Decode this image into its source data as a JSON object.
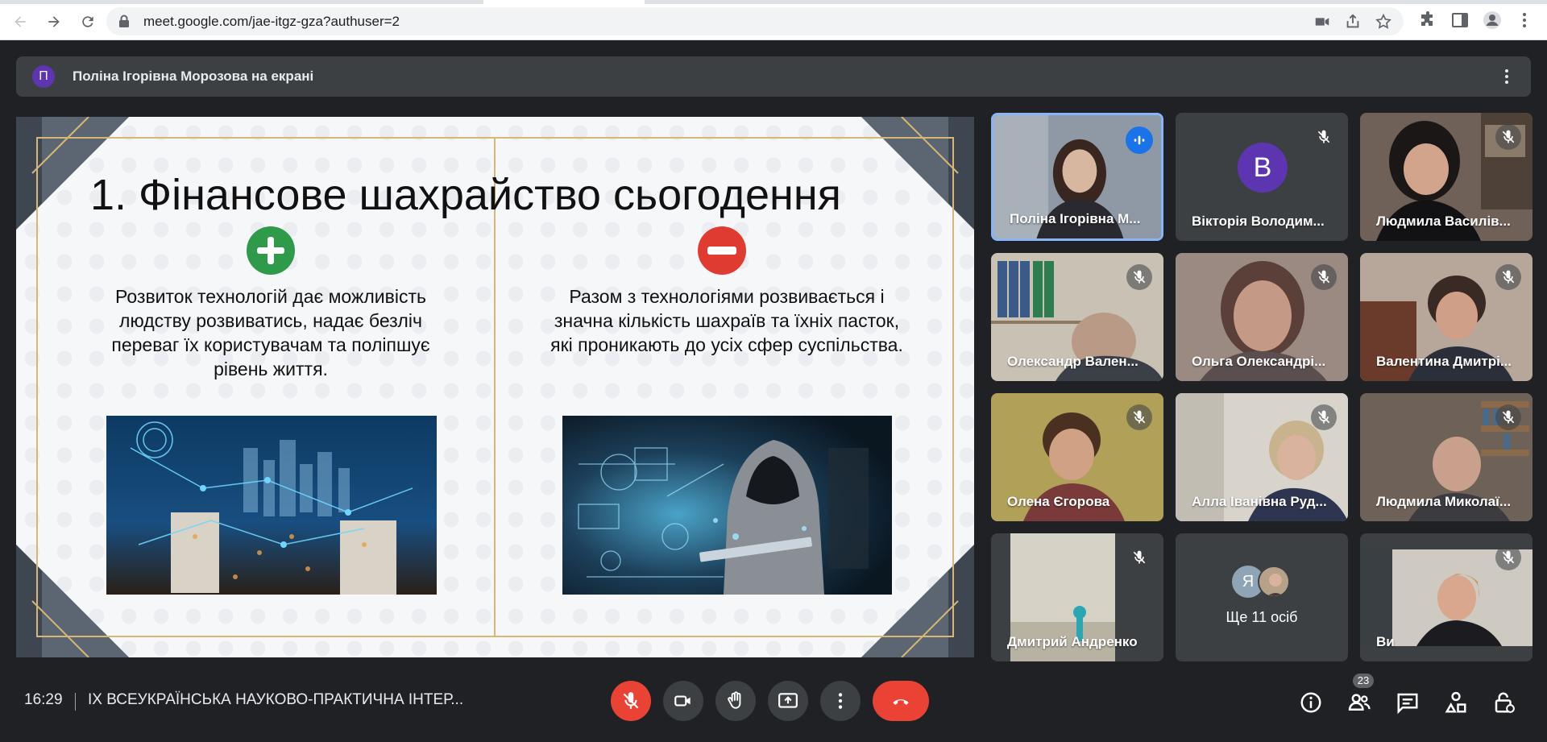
{
  "browser": {
    "url": "meet.google.com/jae-itgz-gza?authuser=2"
  },
  "banner": {
    "avatar_initial": "П",
    "text": "Поліна Ігорівна Морозова на екрані"
  },
  "slide": {
    "title": "1. Фінансове шахрайство сьогодення",
    "left_text": "Розвиток технологій дає можливість людству розвиватись, надає безліч переваг їх користувачам та поліпшує рівень життя.",
    "right_text": "Разом з технологіями розвивається і значна кількість шахраїв та їхніх пасток, які проникають до усіх сфер суспільства.",
    "left_sign_icon": "plus-circle-icon",
    "right_sign_icon": "minus-circle-icon"
  },
  "participants": [
    {
      "name": "Поліна Ігорівна М...",
      "state": "speaking"
    },
    {
      "name": "Вікторія Володим...",
      "state": "muted",
      "avatar_initial": "В"
    },
    {
      "name": "Людмила Василів...",
      "state": "muted"
    },
    {
      "name": "Олександр Вален...",
      "state": "muted"
    },
    {
      "name": "Ольга Олександрі...",
      "state": "muted"
    },
    {
      "name": "Валентина Дмитрі...",
      "state": "muted"
    },
    {
      "name": "Олена Єгорова",
      "state": "muted"
    },
    {
      "name": "Алла Іванівна Руд...",
      "state": "muted"
    },
    {
      "name": "Людмила Миколаї...",
      "state": "muted"
    },
    {
      "name": "Дмитрий Андренко",
      "state": "muted"
    },
    {
      "name": "Ще 11 осіб",
      "state": "overflow",
      "avatar_initial": "Я"
    },
    {
      "name": "Ви",
      "state": "muted"
    }
  ],
  "bottom_bar": {
    "time": "16:29",
    "meeting_title": "IX ВСЕУКРАЇНСЬКА НАУКОВО-ПРАКТИЧНА ІНТЕР...",
    "participant_count": "23",
    "colors": {
      "end_call": "#ea4335",
      "mic_off": "#ea4335",
      "bar": "#202124"
    }
  }
}
